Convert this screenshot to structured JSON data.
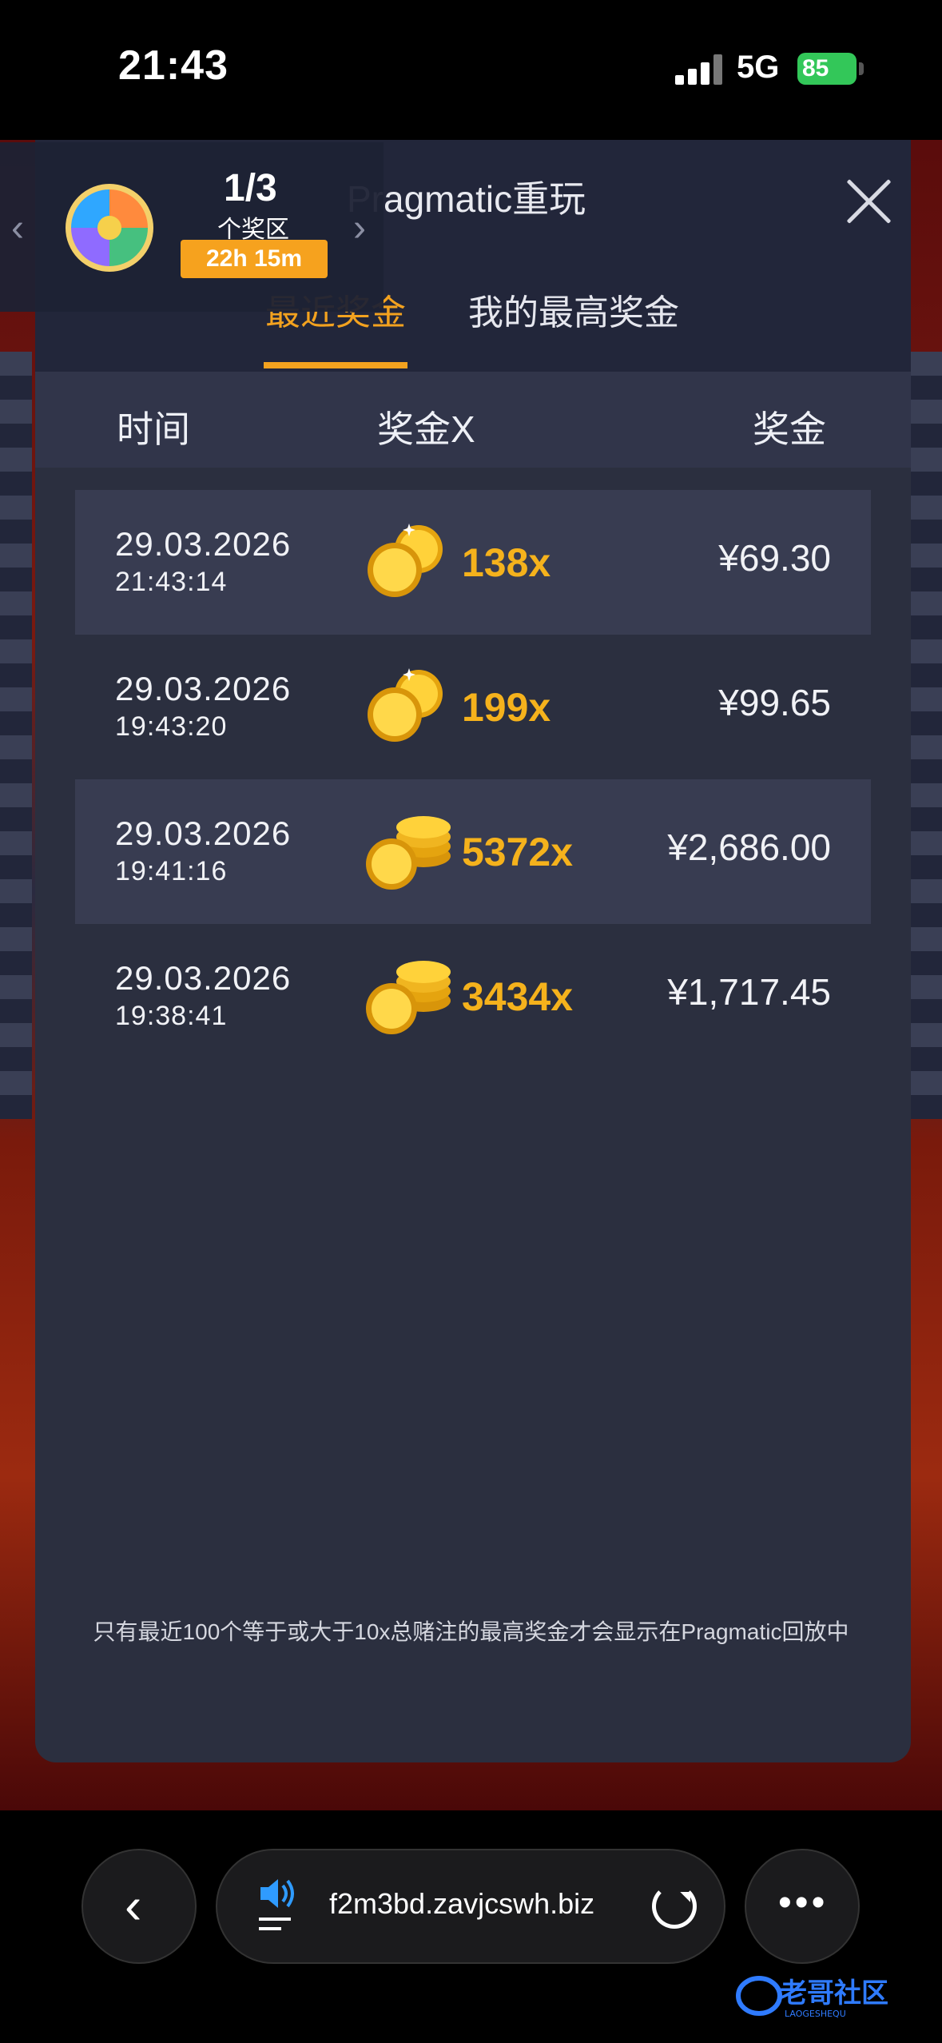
{
  "status_bar": {
    "time": "21:43",
    "network": "5G",
    "battery": "85"
  },
  "modal": {
    "title": "Pragmatic重玩",
    "tabs": [
      {
        "label": "最近奖金",
        "active": true
      },
      {
        "label": "我的最高奖金",
        "active": false
      }
    ],
    "columns": [
      "时间",
      "奖金X",
      "奖金"
    ],
    "rows": [
      {
        "date": "29.03.2026",
        "time": "21:43:14",
        "multiplier": "138x",
        "amount": "¥69.30",
        "coins": "small"
      },
      {
        "date": "29.03.2026",
        "time": "19:43:20",
        "multiplier": "199x",
        "amount": "¥99.65",
        "coins": "small"
      },
      {
        "date": "29.03.2026",
        "time": "19:41:16",
        "multiplier": "5372x",
        "amount": "¥2,686.00",
        "coins": "stack"
      },
      {
        "date": "29.03.2026",
        "time": "19:38:41",
        "multiplier": "3434x",
        "amount": "¥1,717.45",
        "coins": "stack"
      }
    ],
    "footnote": "只有最近100个等于或大于10x总赌注的最高奖金才会显示在Pragmatic回放中"
  },
  "prize_panel": {
    "count": "1/3",
    "label": "个奖区",
    "timer": "22h 15m"
  },
  "browser": {
    "url": "f2m3bd.zavjcswh.biz"
  },
  "colors": {
    "accent": "#f3a21f",
    "modal_bg": "#2b2f3f",
    "header_bg": "#22263a",
    "battery": "#33c759"
  },
  "icons": [
    "signal-icon",
    "battery-icon",
    "close-icon",
    "coin-icon",
    "wheel-icon",
    "chevron-left-icon",
    "chevron-right-icon",
    "speaker-icon",
    "reload-icon",
    "more-icon",
    "back-icon"
  ]
}
